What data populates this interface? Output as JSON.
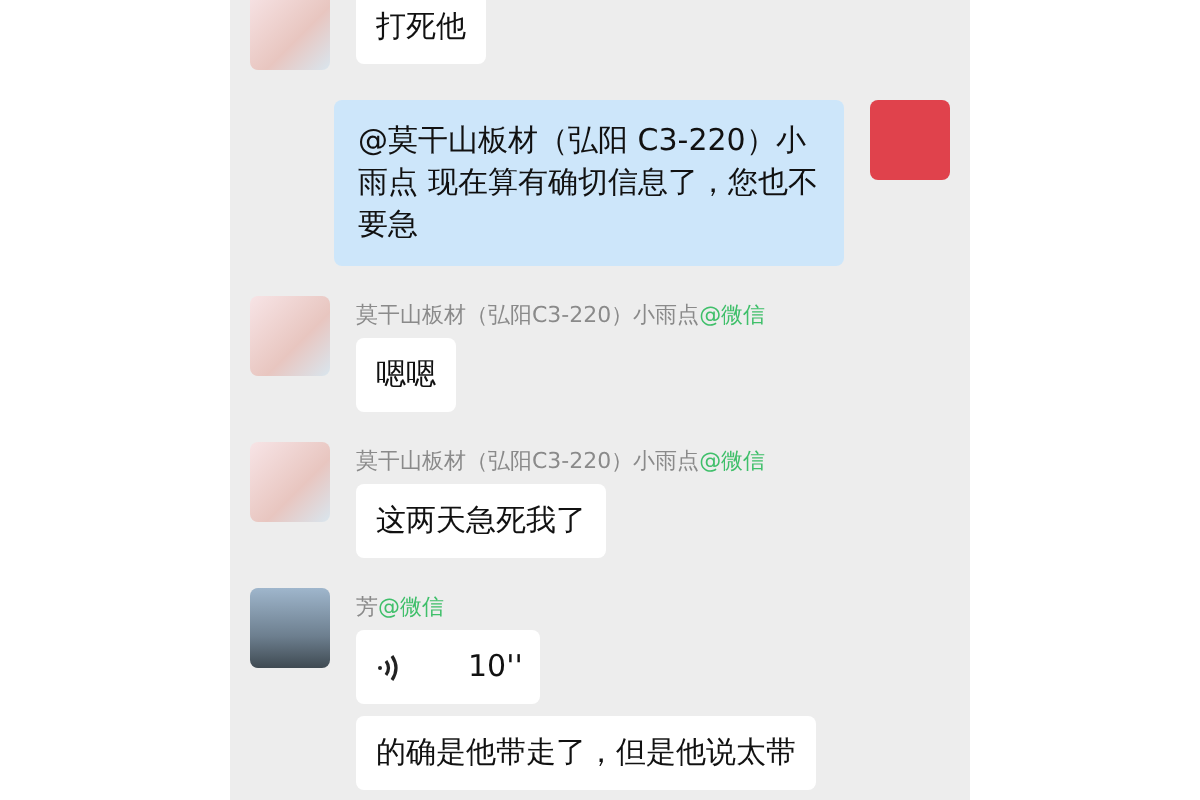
{
  "messages": [
    {
      "kind": "text",
      "outgoing": false,
      "avatar": true,
      "text": "打死他"
    },
    {
      "kind": "text",
      "outgoing": true,
      "avatar": true,
      "text": "@莫干山板材（弘阳 C3-220）小雨点 现在算有确切信息了，您也不要急"
    },
    {
      "kind": "text",
      "outgoing": false,
      "avatar": true,
      "sender": "莫干山板材（弘阳C3-220）小雨点",
      "source": "@微信",
      "text": "嗯嗯"
    },
    {
      "kind": "text",
      "outgoing": false,
      "avatar": true,
      "sender": "莫干山板材（弘阳C3-220）小雨点",
      "source": "@微信",
      "text": "这两天急死我了"
    },
    {
      "kind": "voice",
      "outgoing": false,
      "avatar": true,
      "sender": "芳",
      "source": "@微信",
      "text": "10''"
    },
    {
      "kind": "text",
      "outgoing": false,
      "avatar": false,
      "text": "的确是他带走了，但是他说太带"
    }
  ]
}
